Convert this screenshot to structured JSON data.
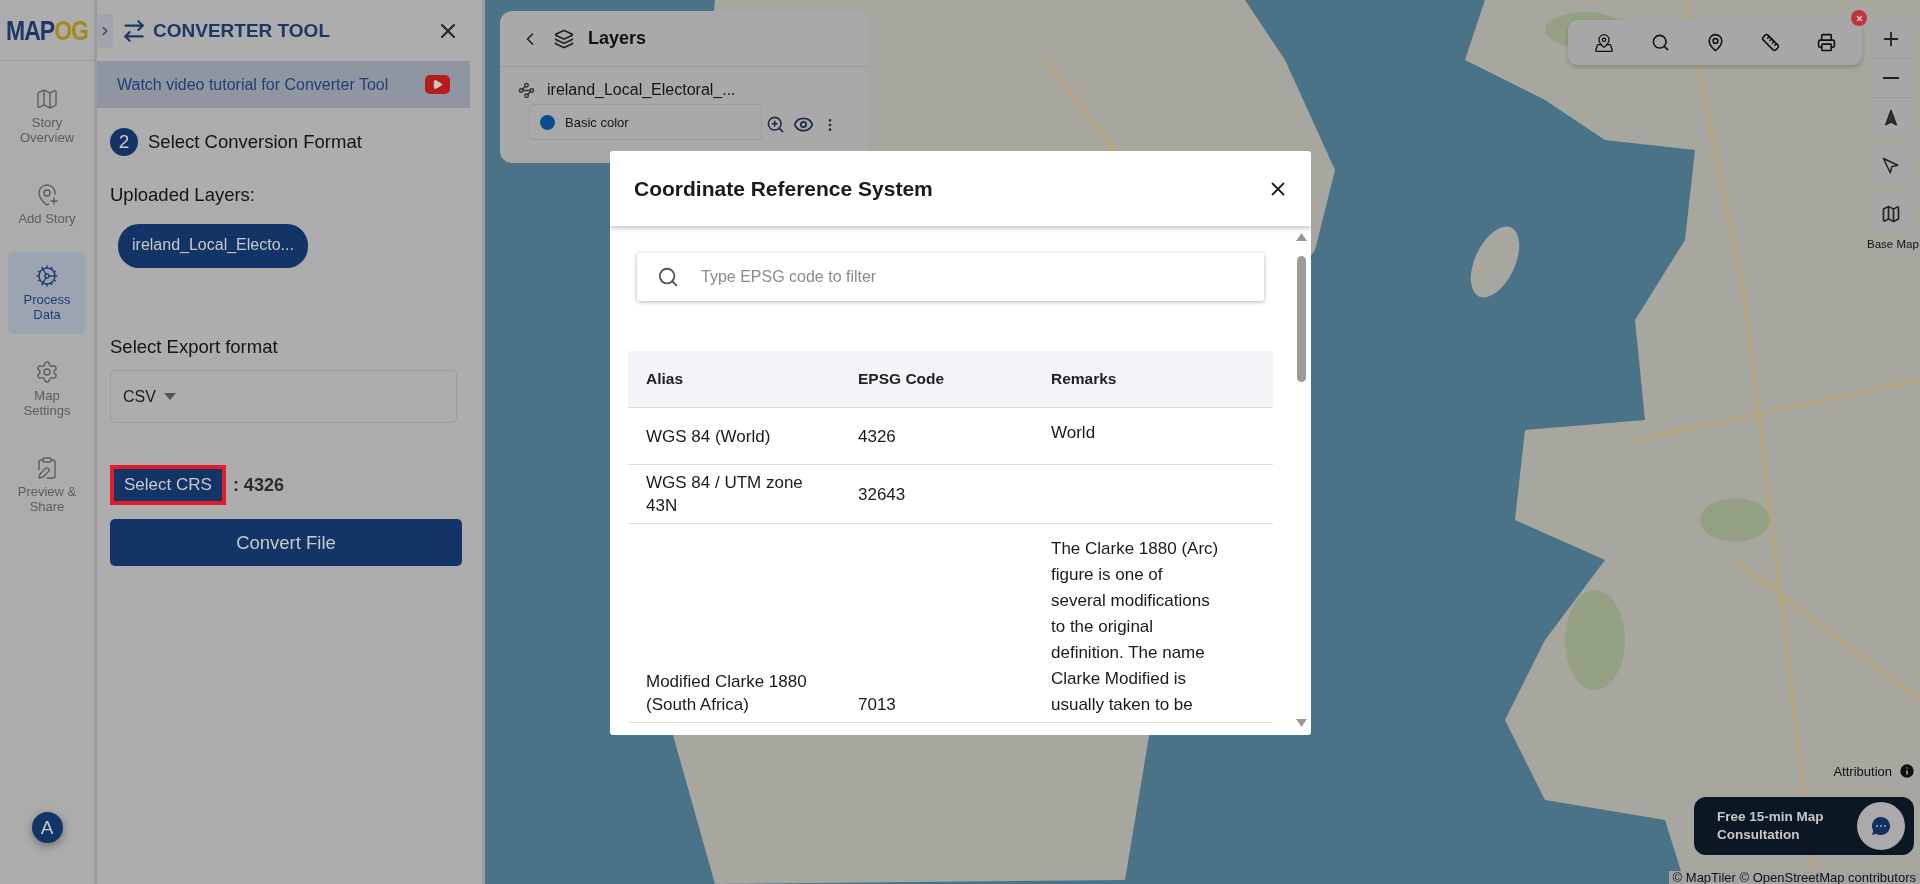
{
  "logo": [
    "MAP",
    "OG"
  ],
  "nav": {
    "items": [
      {
        "label": "Story Overview",
        "selected": false
      },
      {
        "label": "Add Story",
        "selected": false
      },
      {
        "label": "Process Data",
        "selected": true
      },
      {
        "label": "Map Settings",
        "selected": false
      },
      {
        "label": "Preview & Share",
        "selected": false
      }
    ],
    "avatar": "A"
  },
  "panel": {
    "title": "CONVERTER TOOL",
    "tutorial": "Watch video tutorial for Converter Tool",
    "step": {
      "number": "2",
      "title": "Select Conversion Format"
    },
    "uploaded_label": "Uploaded Layers:",
    "layers": [
      "ireland_Local_Electo..."
    ],
    "export_label": "Select Export format",
    "export_format": "CSV",
    "crs_button": "Select CRS",
    "crs_value": ": 4326",
    "convert_button": "Convert File"
  },
  "layers_panel": {
    "title": "Layers",
    "layer": {
      "name": "ireland_Local_Electoral_...",
      "style": "Basic color"
    }
  },
  "map_controls": {
    "base_map_label": "Base Map",
    "attribution": "Attribution",
    "consultation": "Free 15-min Map Consultation",
    "credits": "© MapTiler © OpenStreetMap contributors"
  },
  "modal": {
    "title": "Coordinate Reference System",
    "search": {
      "placeholder": "Type EPSG code to filter"
    },
    "columns": [
      "Alias",
      "EPSG Code",
      "Remarks"
    ],
    "rows": [
      {
        "alias": "WGS 84 (World)",
        "code": "4326",
        "remarks": "World"
      },
      {
        "alias": "WGS 84 / UTM zone 43N",
        "code": "32643"
      },
      {
        "alias": "Modified Clarke 1880 (South Africa)",
        "code": "7013",
        "remarks": "The Clarke 1880 (Arc) figure is one of several modifications to the original definition. The name Clarke Modified is usually taken to be"
      }
    ]
  }
}
